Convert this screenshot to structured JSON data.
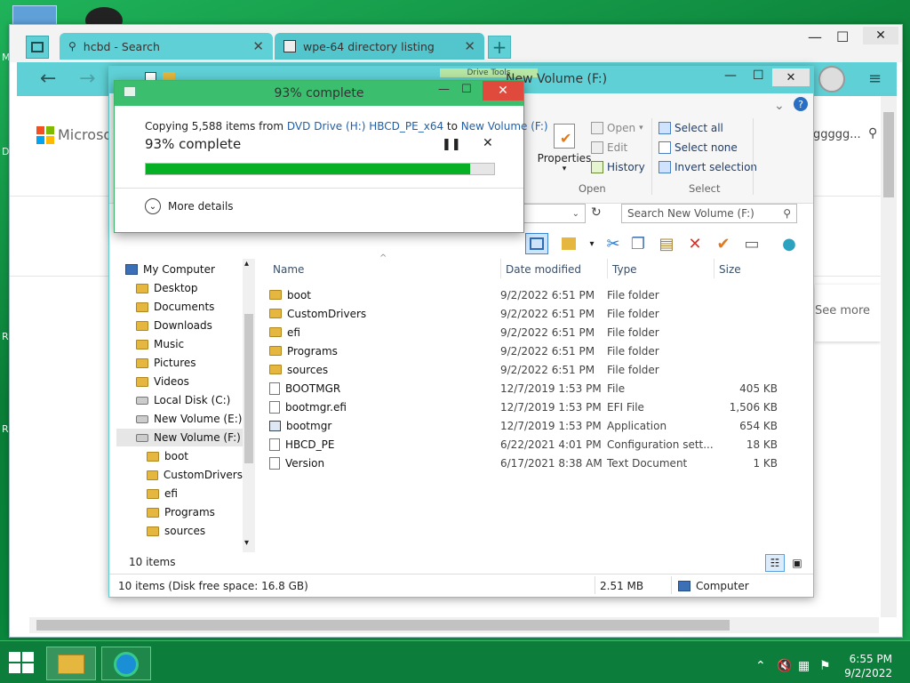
{
  "desktop": {
    "letters": [
      "M",
      "D",
      "R",
      "R"
    ]
  },
  "browser": {
    "tabs": [
      {
        "label": "hcbd - Search"
      },
      {
        "label": "wpe-64 directory listing"
      }
    ],
    "new_tab": "+",
    "ms_brand": "Microsoft",
    "search_fragment": "ggggg...",
    "see_more": "See more"
  },
  "explorer": {
    "title": "New Volume (F:)",
    "ribbon_tab": "Drive Tools",
    "ribbon": {
      "properties": "Properties",
      "open": "Open",
      "edit": "Edit",
      "history": "History",
      "group_open": "Open",
      "select_all": "Select all",
      "select_none": "Select none",
      "invert": "Invert selection",
      "group_select": "Select"
    },
    "search_placeholder": "Search New Volume (F:)",
    "columns": {
      "name": "Name",
      "date": "Date modified",
      "type": "Type",
      "size": "Size"
    },
    "tree": [
      {
        "label": "My Computer",
        "kind": "computer",
        "indent": 0
      },
      {
        "label": "Desktop",
        "kind": "folder",
        "indent": 1
      },
      {
        "label": "Documents",
        "kind": "folder",
        "indent": 1
      },
      {
        "label": "Downloads",
        "kind": "folder",
        "indent": 1
      },
      {
        "label": "Music",
        "kind": "folder",
        "indent": 1
      },
      {
        "label": "Pictures",
        "kind": "folder",
        "indent": 1
      },
      {
        "label": "Videos",
        "kind": "folder",
        "indent": 1
      },
      {
        "label": "Local Disk (C:)",
        "kind": "drive",
        "indent": 1
      },
      {
        "label": "New Volume (E:)",
        "kind": "drive",
        "indent": 1
      },
      {
        "label": "New Volume (F:)",
        "kind": "drive",
        "indent": 1,
        "selected": true
      },
      {
        "label": "boot",
        "kind": "folder",
        "indent": 2
      },
      {
        "label": "CustomDrivers",
        "kind": "folder",
        "indent": 2
      },
      {
        "label": "efi",
        "kind": "folder",
        "indent": 2
      },
      {
        "label": "Programs",
        "kind": "folder",
        "indent": 2
      },
      {
        "label": "sources",
        "kind": "folder",
        "indent": 2
      }
    ],
    "files": [
      {
        "name": "boot",
        "date": "9/2/2022 6:51 PM",
        "type": "File folder",
        "size": "",
        "kind": "folder"
      },
      {
        "name": "CustomDrivers",
        "date": "9/2/2022 6:51 PM",
        "type": "File folder",
        "size": "",
        "kind": "folder"
      },
      {
        "name": "efi",
        "date": "9/2/2022 6:51 PM",
        "type": "File folder",
        "size": "",
        "kind": "folder"
      },
      {
        "name": "Programs",
        "date": "9/2/2022 6:51 PM",
        "type": "File folder",
        "size": "",
        "kind": "folder"
      },
      {
        "name": "sources",
        "date": "9/2/2022 6:51 PM",
        "type": "File folder",
        "size": "",
        "kind": "folder"
      },
      {
        "name": "BOOTMGR",
        "date": "12/7/2019 1:53 PM",
        "type": "File",
        "size": "405 KB",
        "kind": "file"
      },
      {
        "name": "bootmgr.efi",
        "date": "12/7/2019 1:53 PM",
        "type": "EFI File",
        "size": "1,506 KB",
        "kind": "file"
      },
      {
        "name": "bootmgr",
        "date": "12/7/2019 1:53 PM",
        "type": "Application",
        "size": "654 KB",
        "kind": "app"
      },
      {
        "name": "HBCD_PE",
        "date": "6/22/2021 4:01 PM",
        "type": "Configuration sett...",
        "size": "18 KB",
        "kind": "file"
      },
      {
        "name": "Version",
        "date": "6/17/2021 8:38 AM",
        "type": "Text Document",
        "size": "1 KB",
        "kind": "file"
      }
    ],
    "item_count": "10 items",
    "status_left": "10 items (Disk free space: 16.8 GB)",
    "status_size": "2.51 MB",
    "status_location": "Computer"
  },
  "copy_dialog": {
    "title": "93% complete",
    "copy_prefix": "Copying 5,588 items from ",
    "source": "DVD Drive (H:) HBCD_PE_x64",
    "to_word": " to ",
    "destination": "New Volume (F:)",
    "percent_text": "93% complete",
    "progress": 0.93,
    "more_details": "More details"
  },
  "taskbar": {
    "time": "6:55 PM",
    "date": "9/2/2022"
  },
  "colors": {
    "accent": "#5fd1d6",
    "dialog_title": "#3bbf6e",
    "progress": "#06b025",
    "close": "#e04a3c"
  }
}
